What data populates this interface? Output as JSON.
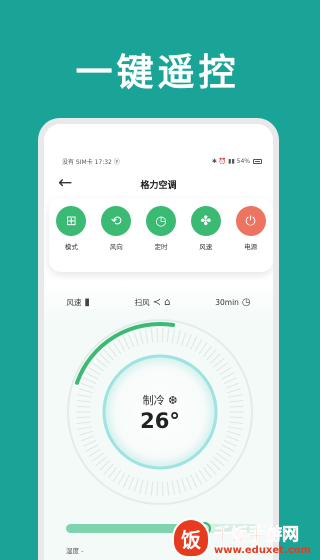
{
  "headline": "一键遥控",
  "status": {
    "left": "没有 SIM卡 17:32 ⓟ",
    "right": "✱ ⏰ ▮▮ 54%"
  },
  "appbar": {
    "back_icon": "arrow-left-icon",
    "title": "格力空调"
  },
  "modes": [
    {
      "name": "mode",
      "label": "模式",
      "icon": "grid-icon",
      "glyph": "⊞",
      "color": "#3aba73"
    },
    {
      "name": "wind-direction",
      "label": "风向",
      "icon": "swap-icon",
      "glyph": "⟲",
      "color": "#3aba73"
    },
    {
      "name": "timer",
      "label": "定时",
      "icon": "clock-icon",
      "glyph": "◷",
      "color": "#3aba73"
    },
    {
      "name": "fan-speed",
      "label": "风速",
      "icon": "fan-icon",
      "glyph": "✤",
      "color": "#3aba73"
    },
    {
      "name": "power",
      "label": "电源",
      "icon": "power-icon",
      "glyph": "⏻",
      "color": "#ee7462"
    }
  ],
  "controls": {
    "fan_speed_label": "风速",
    "fan_speed_glyph": "▮",
    "swing_label": "扫风",
    "swing_glyph": "≺ ⌂",
    "timer_value": "30min",
    "timer_glyph": "◷"
  },
  "dial": {
    "mode_label": "制冷 ❆",
    "temperature": "26°",
    "progress": 0.22
  },
  "slider": {
    "fill_fraction": 0.72
  },
  "humidity_label": "湿度 -",
  "colors": {
    "background": "#1aa497",
    "accent": "#3aba73",
    "power": "#ee7462"
  },
  "watermark": {
    "badge": "饭",
    "main": "千饭手游网",
    "url": "www.eduxet.com"
  }
}
